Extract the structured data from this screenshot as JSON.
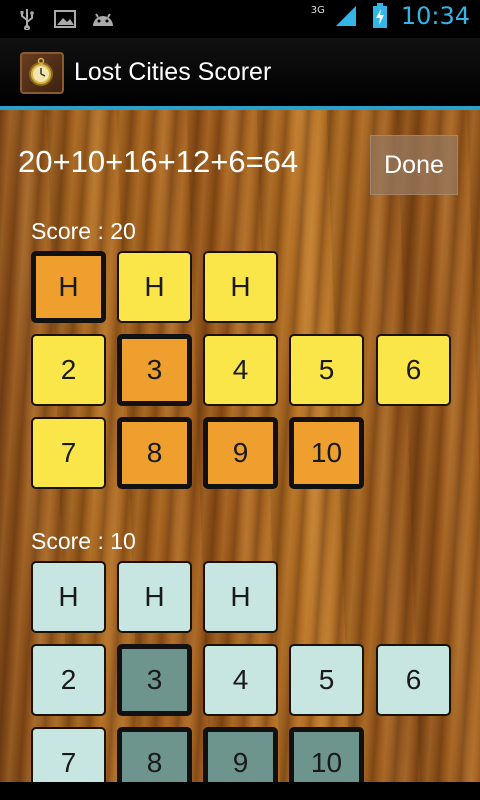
{
  "status_bar": {
    "network": "3G",
    "time": "10:34",
    "icons": [
      "usb-icon",
      "image-icon",
      "android-icon",
      "signal-icon",
      "battery-charging-icon"
    ]
  },
  "action_bar": {
    "title": "Lost Cities Scorer",
    "icon": "pocket-watch-icon"
  },
  "equation": "20+10+16+12+6=64",
  "done_label": "Done",
  "expeditions": [
    {
      "score_label": "Score : 20",
      "color": "yellow",
      "unselected_color": "#fbe64a",
      "selected_color": "#ef9f2e",
      "rows": [
        [
          {
            "label": "H",
            "selected": true
          },
          {
            "label": "H",
            "selected": false
          },
          {
            "label": "H",
            "selected": false
          }
        ],
        [
          {
            "label": "2",
            "selected": false
          },
          {
            "label": "3",
            "selected": true
          },
          {
            "label": "4",
            "selected": false
          },
          {
            "label": "5",
            "selected": false
          },
          {
            "label": "6",
            "selected": false
          }
        ],
        [
          {
            "label": "7",
            "selected": false
          },
          {
            "label": "8",
            "selected": true
          },
          {
            "label": "9",
            "selected": true
          },
          {
            "label": "10",
            "selected": true
          }
        ]
      ]
    },
    {
      "score_label": "Score : 10",
      "color": "teal",
      "unselected_color": "#c7e6e2",
      "selected_color": "#6d958d",
      "rows": [
        [
          {
            "label": "H",
            "selected": false
          },
          {
            "label": "H",
            "selected": false
          },
          {
            "label": "H",
            "selected": false
          }
        ],
        [
          {
            "label": "2",
            "selected": false
          },
          {
            "label": "3",
            "selected": true
          },
          {
            "label": "4",
            "selected": false
          },
          {
            "label": "5",
            "selected": false
          },
          {
            "label": "6",
            "selected": false
          }
        ],
        [
          {
            "label": "7",
            "selected": false
          },
          {
            "label": "8",
            "selected": true
          },
          {
            "label": "9",
            "selected": true
          },
          {
            "label": "10",
            "selected": true
          }
        ]
      ]
    }
  ]
}
